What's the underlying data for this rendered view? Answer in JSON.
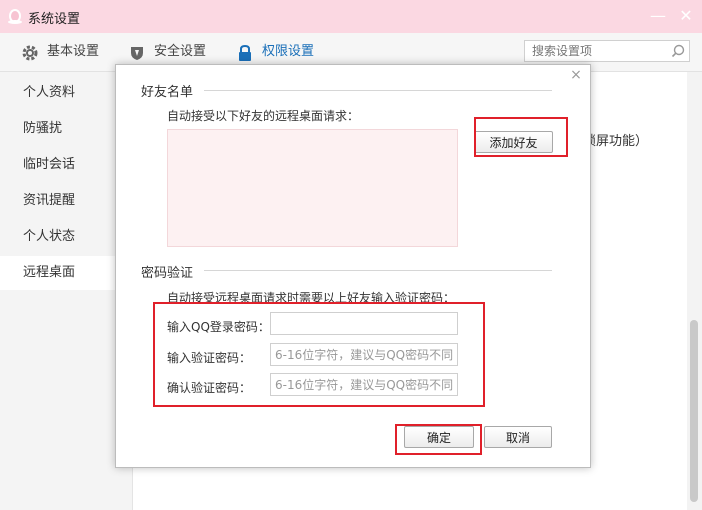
{
  "window": {
    "title": "系统设置",
    "minimize_glyph": "—",
    "close_glyph": "✕"
  },
  "tabs": [
    {
      "label": "基本设置",
      "icon": "gear-icon"
    },
    {
      "label": "安全设置",
      "icon": "shield-icon"
    },
    {
      "label": "权限设置",
      "icon": "lock-icon",
      "active": true
    }
  ],
  "search": {
    "placeholder": "搜索设置项",
    "icon": "search-icon"
  },
  "sidebar": {
    "items": [
      {
        "label": "个人资料"
      },
      {
        "label": "防骚扰"
      },
      {
        "label": "临时会话"
      },
      {
        "label": "资讯提醒"
      },
      {
        "label": "个人状态"
      },
      {
        "label": "远程桌面",
        "active": true
      }
    ]
  },
  "background": {
    "partial_text": "锁屏功能）"
  },
  "dialog": {
    "close_glyph": "×",
    "friends_section": {
      "title": "好友名单",
      "description": "自动接受以下好友的远程桌面请求：",
      "add_button": "添加好友"
    },
    "password_section": {
      "title": "密码验证",
      "description": "自动接受远程桌面请求时需要以上好友输入验证密码：",
      "fields": [
        {
          "label": "输入QQ登录密码：",
          "value": "",
          "placeholder": ""
        },
        {
          "label": "输入验证密码：",
          "value": "",
          "placeholder": "6-16位字符，建议与QQ密码不同"
        },
        {
          "label": "确认验证密码：",
          "value": "",
          "placeholder": "6-16位字符，建议与QQ密码不同"
        }
      ]
    },
    "ok_button": "确定",
    "cancel_button": "取消"
  },
  "colors": {
    "titlebar_bg": "#fbd8e2",
    "active_tab_text": "#1a6fb8",
    "highlight_border": "#e0202a",
    "friend_list_bg": "#fdf1f2"
  }
}
